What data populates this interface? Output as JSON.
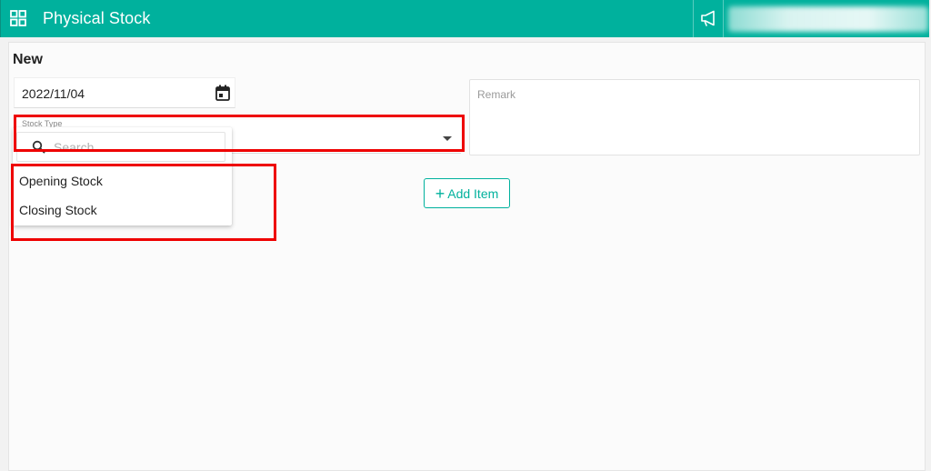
{
  "header": {
    "title": "Physical Stock",
    "grid_icon": "grid-icon",
    "announcement_icon": "megaphone-icon",
    "color": "#00b19d"
  },
  "form": {
    "section_title": "New",
    "date": {
      "value": "2022/11/04",
      "icon": "calendar-icon"
    },
    "remark": {
      "label": "Remark"
    },
    "stock_type": {
      "label": "Stock Type",
      "search_placeholder": "Search",
      "options": [
        "Opening Stock",
        "Closing Stock"
      ]
    },
    "add_item_label": "Add Item",
    "add_item_icon": "+"
  },
  "annotations": {
    "highlight_color": "#ee0000"
  }
}
